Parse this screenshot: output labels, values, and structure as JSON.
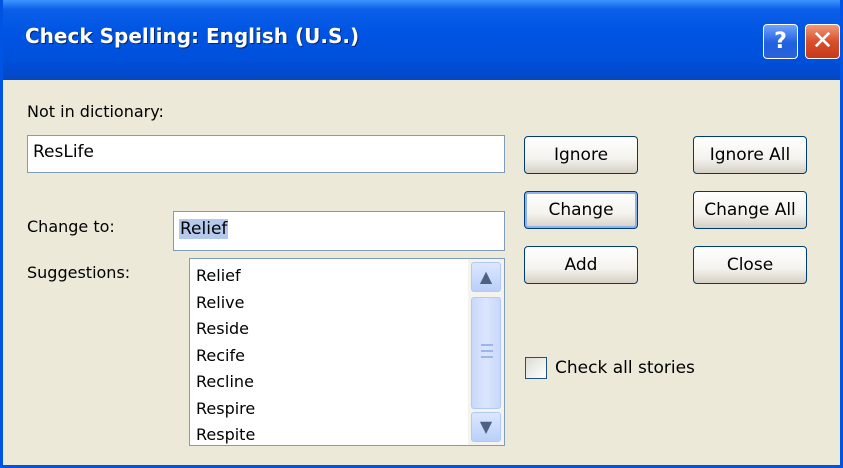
{
  "window": {
    "title": "Check Spelling: English (U.S.)",
    "help_glyph": "?",
    "close_glyph": "✕"
  },
  "not_in_dictionary": {
    "label": "Not in dictionary:",
    "value": "ResLife"
  },
  "change_to": {
    "label": "Change to:",
    "value": "Relief"
  },
  "suggestions": {
    "label": "Suggestions:",
    "items": [
      "Relief",
      "Relive",
      "Reside",
      "Recife",
      "Recline",
      "Respire",
      "Respite"
    ]
  },
  "buttons": {
    "ignore": "Ignore",
    "ignore_all": "Ignore All",
    "change": "Change",
    "change_all": "Change All",
    "add": "Add",
    "close": "Close"
  },
  "check_all_stories": {
    "label": "Check all stories",
    "checked": false
  },
  "icons": {
    "scroll_up": "scroll-up-arrow-icon",
    "scroll_down": "scroll-down-arrow-icon"
  },
  "colors": {
    "titlebar": "#0054e3",
    "dialog_bg": "#ece9d8",
    "selection": "#b5c9ec"
  }
}
